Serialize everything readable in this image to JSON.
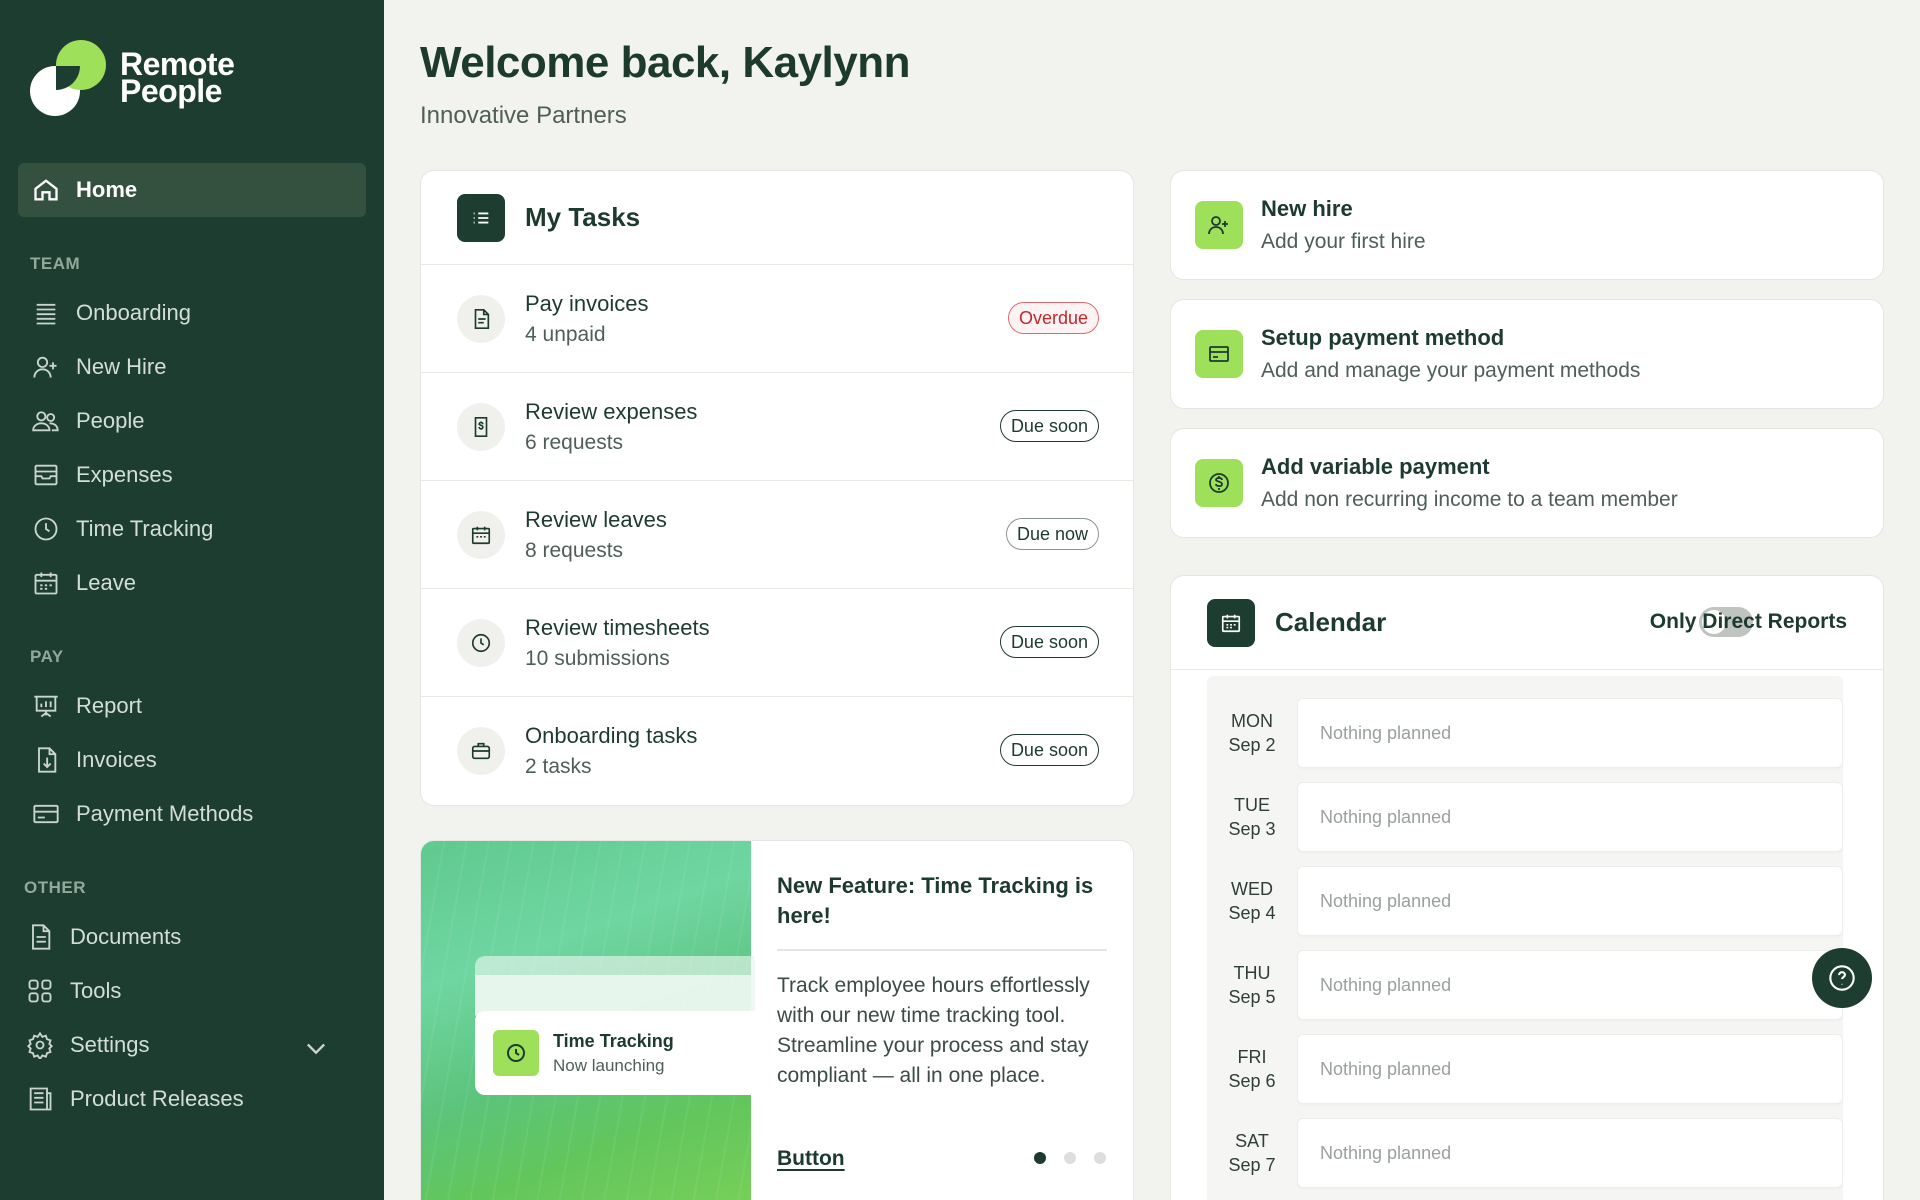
{
  "brand": {
    "line1": "Remote",
    "line2": "People"
  },
  "sidebar": {
    "home": "Home",
    "sections": {
      "team": "TEAM",
      "pay": "PAY",
      "other": "OTHER"
    },
    "team_items": [
      "Onboarding",
      "New Hire",
      "People",
      "Expenses",
      "Time Tracking",
      "Leave"
    ],
    "pay_items": [
      "Report",
      "Invoices",
      "Payment Methods"
    ],
    "other_items": [
      "Documents",
      "Tools",
      "Settings",
      "Product Releases"
    ]
  },
  "header": {
    "welcome": "Welcome back, Kaylynn",
    "company": "Innovative Partners"
  },
  "tasks": {
    "title": "My Tasks",
    "items": [
      {
        "title": "Pay invoices",
        "sub": "4 unpaid",
        "badge": "Overdue",
        "icon": "file-icon"
      },
      {
        "title": "Review expenses",
        "sub": "6 requests",
        "badge": "Due soon",
        "icon": "receipt-icon"
      },
      {
        "title": "Review leaves",
        "sub": "8 requests",
        "badge": "Due now",
        "icon": "calendar-icon"
      },
      {
        "title": "Review timesheets",
        "sub": "10 submissions",
        "badge": "Due soon",
        "icon": "clock-icon"
      },
      {
        "title": "Onboarding tasks",
        "sub": "2 tasks",
        "badge": "Due soon",
        "icon": "briefcase-icon"
      }
    ]
  },
  "feature": {
    "mini_title": "Time Tracking",
    "mini_sub": "Now launching",
    "title": "New Feature: Time Tracking is here!",
    "text": "Track employee hours effortlessly with our new time tracking tool. Streamline your process and stay compliant — all in one place.",
    "link": "Button"
  },
  "actions": [
    {
      "title": "New hire",
      "sub": "Add your first hire",
      "icon": "add-user-icon"
    },
    {
      "title": "Setup payment method",
      "sub": "Add and manage your payment methods",
      "icon": "credit-card-icon"
    },
    {
      "title": "Add variable payment",
      "sub": "Add non recurring income to a team member",
      "icon": "dollar-icon"
    }
  ],
  "calendar": {
    "title": "Calendar",
    "toggle_label": "Only Direct Reports",
    "toggle_on": false,
    "days": [
      {
        "dow": "MON",
        "date": "Sep 2",
        "text": "Nothing planned"
      },
      {
        "dow": "TUE",
        "date": "Sep 3",
        "text": "Nothing planned"
      },
      {
        "dow": "WED",
        "date": "Sep 4",
        "text": "Nothing planned"
      },
      {
        "dow": "THU",
        "date": "Sep 5",
        "text": "Nothing planned"
      },
      {
        "dow": "FRI",
        "date": "Sep 6",
        "text": "Nothing planned"
      },
      {
        "dow": "SAT",
        "date": "Sep 7",
        "text": "Nothing planned"
      }
    ]
  },
  "colors": {
    "sidebar": "#1e3d31",
    "accent": "#9ee05a",
    "text": "#1d3a2f",
    "overdue": "#c0282d"
  }
}
